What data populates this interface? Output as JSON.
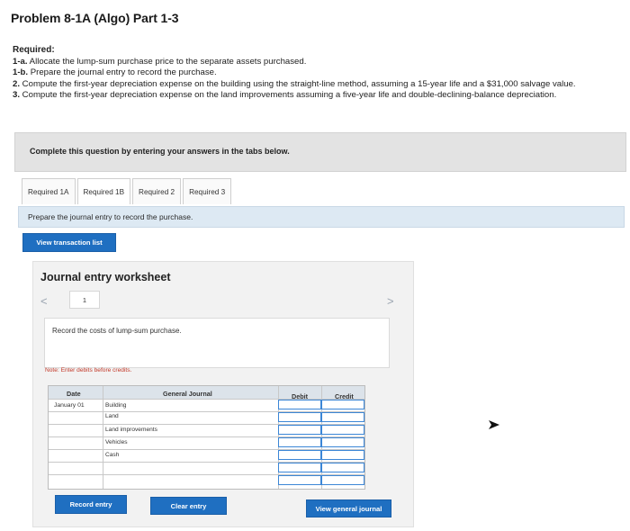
{
  "page": {
    "title": "Problem 8-1A (Algo) Part 1-3"
  },
  "requirements": {
    "heading": "Required:",
    "items": [
      {
        "num": "1-a.",
        "text": " Allocate the lump-sum purchase price to the separate assets purchased."
      },
      {
        "num": "1-b.",
        "text": " Prepare the journal entry to record the purchase."
      },
      {
        "num": "2.",
        "text": " Compute the first-year depreciation expense on the building using the straight-line method, assuming a 15-year life and a $31,000 salvage value."
      },
      {
        "num": "3.",
        "text": " Compute the first-year depreciation expense on the land improvements assuming a five-year life and double-declining-balance depreciation."
      }
    ]
  },
  "instructions": {
    "complete_text": "Complete this question by entering your answers in the tabs below."
  },
  "tabs": [
    {
      "label": "Required 1A",
      "active": false
    },
    {
      "label": "Required 1B",
      "active": true
    },
    {
      "label": "Required 2",
      "active": false
    },
    {
      "label": "Required 3",
      "active": false
    }
  ],
  "prompt": "Prepare the journal entry to record the purchase.",
  "buttons": {
    "view_transaction_list": "View transaction list",
    "record_entry": "Record entry",
    "clear_entry": "Clear entry",
    "view_general_journal": "View general journal"
  },
  "worksheet": {
    "title": "Journal entry worksheet",
    "nav_prev": "<",
    "nav_next": ">",
    "current_page": "1",
    "record_text": "Record the costs of lump-sum purchase.",
    "note": "Note: Enter debits before credits."
  },
  "journal": {
    "headers": {
      "date": "Date",
      "general_journal": "General Journal",
      "debit": "Debit",
      "credit": "Credit"
    },
    "date_value": "January 01",
    "accounts": [
      "Building",
      "Land",
      "Land improvements",
      "Vehicles",
      "Cash",
      "",
      ""
    ]
  },
  "colors": {
    "accent_blue": "#1f6fc1",
    "input_border": "#3b86d6",
    "note_red": "#c43a2a",
    "prompt_bg": "#dde9f3"
  }
}
